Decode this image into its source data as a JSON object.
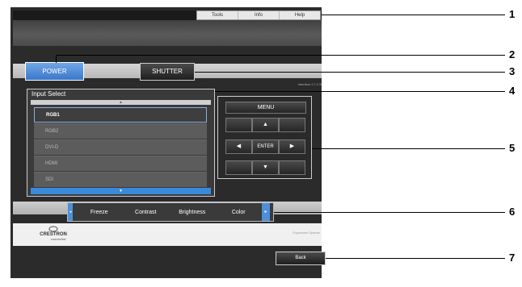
{
  "toolbar": {
    "tabs": [
      "Tools",
      "Info",
      "Help"
    ]
  },
  "buttons": {
    "power": "POWER",
    "shutter": "SHUTTER",
    "back": "Back"
  },
  "interface_version": "Interface 2.7.2 B",
  "input_select": {
    "title": "Input Select",
    "scroll_up": "▲",
    "scroll_down": "▼",
    "items": [
      "RGB1",
      "RGB2",
      "DVI-D",
      "HDMI",
      "SDI"
    ],
    "selected": "RGB1"
  },
  "menu_pad": {
    "menu": "MENU",
    "enter": "ENTER",
    "up": "▲",
    "down": "▼",
    "left": "◀",
    "right": "▶"
  },
  "adjust": {
    "items": [
      "Freeze",
      "Contrast",
      "Brightness",
      "Color"
    ],
    "left_arrow": "◂",
    "right_arrow": "▸"
  },
  "expansion_options": "Expansion Options",
  "logo": {
    "line1": "CRESTRON",
    "line2": "connected"
  },
  "callouts": [
    "1",
    "2",
    "3",
    "4",
    "5",
    "6",
    "7"
  ],
  "colors": {
    "power_blue": "#3b77c9",
    "selection_blue": "#3a8ad9"
  }
}
